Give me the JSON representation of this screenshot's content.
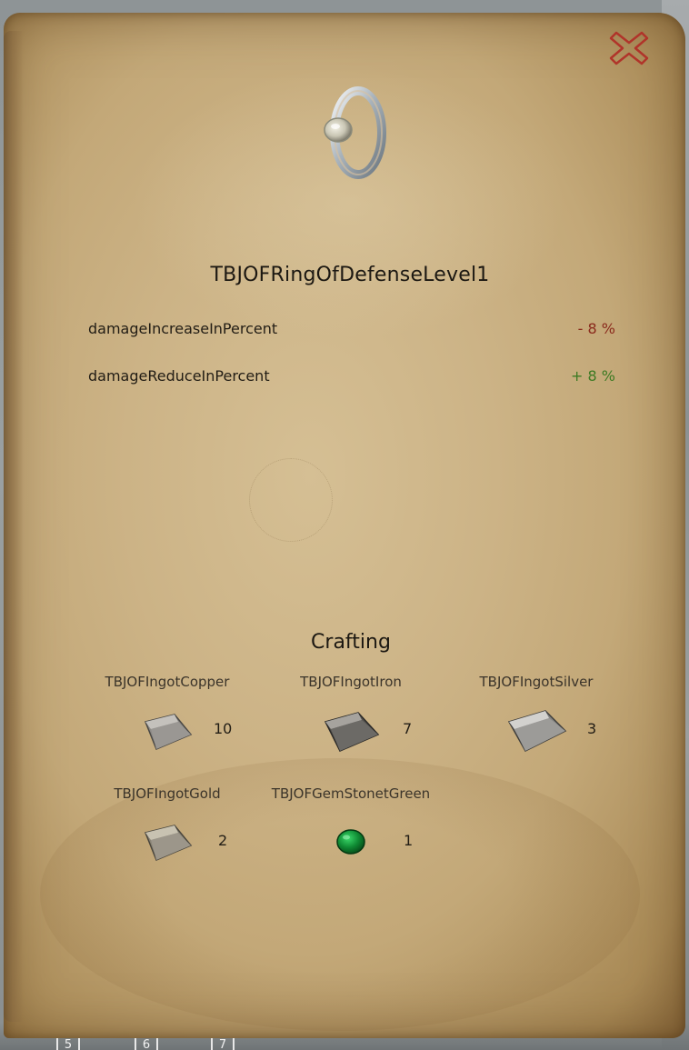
{
  "item": {
    "title": "TBJOFRingOfDefenseLevel1",
    "icon": "silver-ring-with-gem-icon"
  },
  "stats": [
    {
      "name": "damageIncreaseInPercent",
      "value": "- 8 %",
      "tone": "negative",
      "color": "#8a2a1c"
    },
    {
      "name": "damageReduceInPercent",
      "value": "+ 8 %",
      "tone": "positive",
      "color": "#3d7a23"
    }
  ],
  "crafting": {
    "title": "Crafting",
    "ingredients": [
      {
        "name": "TBJOFIngotCopper",
        "count": "10",
        "icon": "ingot-icon"
      },
      {
        "name": "TBJOFIngotIron",
        "count": "7",
        "icon": "ingot-icon"
      },
      {
        "name": "TBJOFIngotSilver",
        "count": "3",
        "icon": "ingot-icon"
      },
      {
        "name": "TBJOFIngotGold",
        "count": "2",
        "icon": "ingot-icon"
      },
      {
        "name": "TBJOFGemStonetGreen",
        "count": "1",
        "icon": "green-gem-icon"
      }
    ]
  },
  "controls": {
    "close_icon": "close-x-icon",
    "close_color": "#b0342a"
  },
  "hotbar": {
    "slots": [
      "5",
      "6",
      "7"
    ]
  }
}
